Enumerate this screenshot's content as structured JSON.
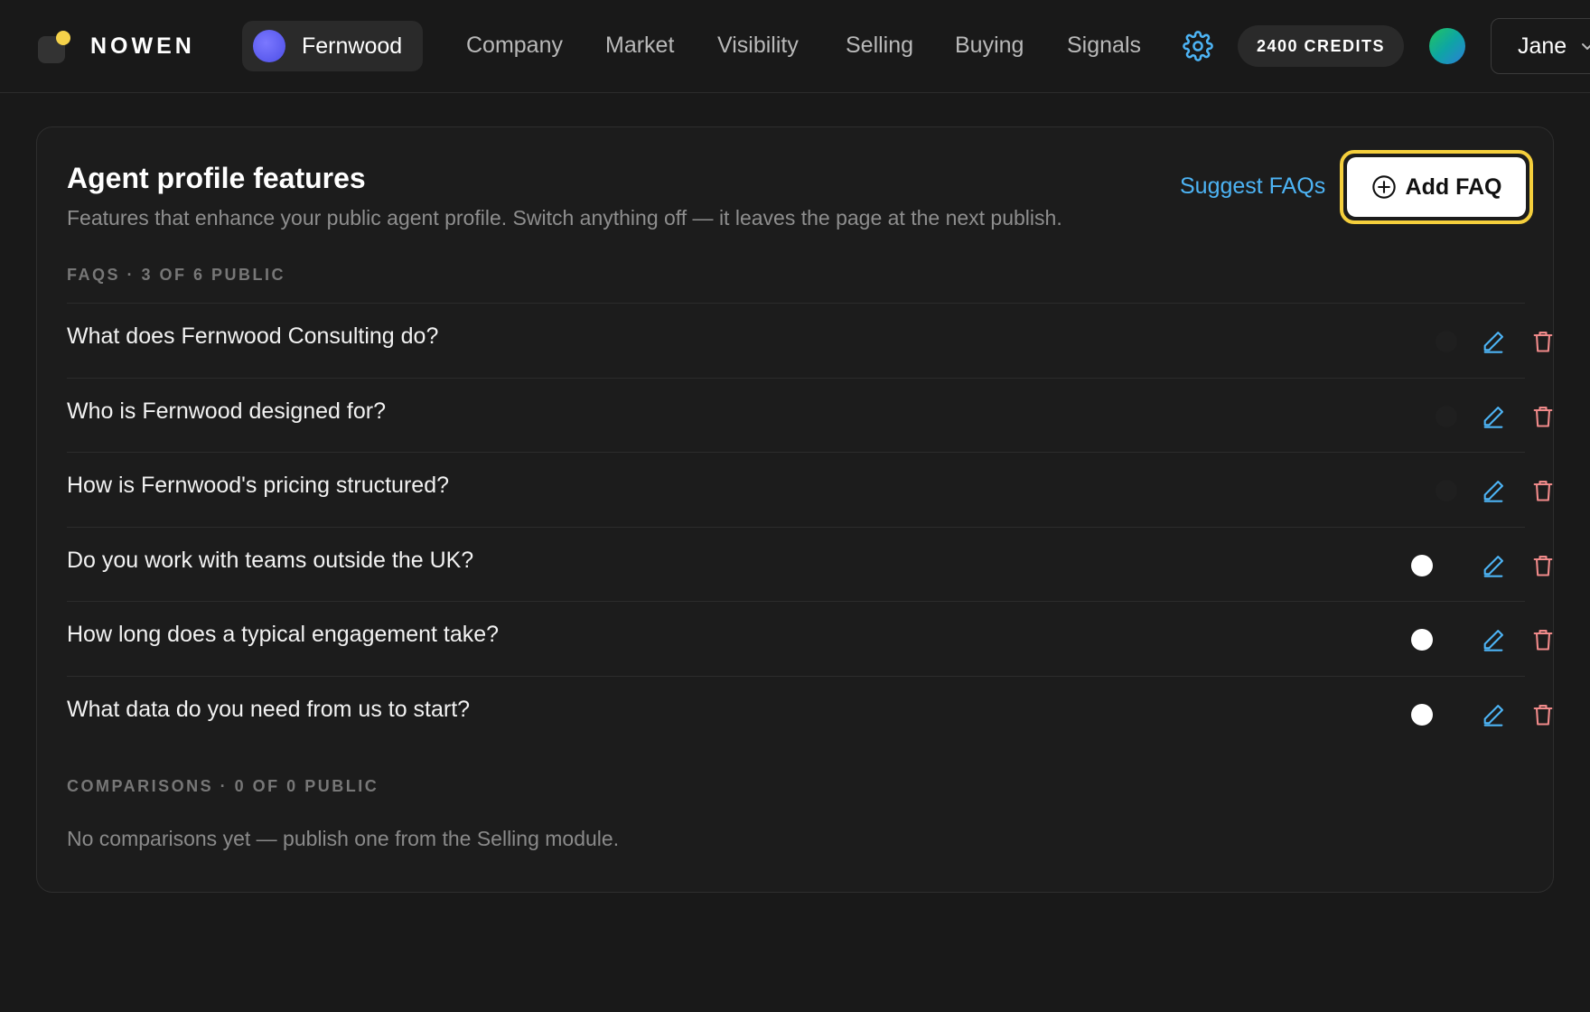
{
  "app": {
    "brand": "NOWEN"
  },
  "workspace": {
    "name": "Fernwood"
  },
  "nav": {
    "items": [
      {
        "label": "Company"
      },
      {
        "label": "Market"
      },
      {
        "label": "Visibility"
      },
      {
        "label": "Selling"
      },
      {
        "label": "Buying"
      },
      {
        "label": "Signals"
      }
    ]
  },
  "header": {
    "credits": "2400 CREDITS",
    "user": "Jane",
    "settings_icon": "gear-icon"
  },
  "card": {
    "title": "Agent profile features",
    "subtitle": "Features that enhance your public agent profile. Switch anything off — it leaves the page at the next publish.",
    "suggest_label": "Suggest FAQs",
    "add_label": "Add FAQ"
  },
  "faqs": {
    "section_label": "FAQS · 3 OF 6 PUBLIC",
    "items": [
      {
        "question": "What does Fernwood Consulting do?",
        "public": false
      },
      {
        "question": "Who is Fernwood designed for?",
        "public": false
      },
      {
        "question": "How is Fernwood's pricing structured?",
        "public": false
      },
      {
        "question": "Do you work with teams outside the UK?",
        "public": true
      },
      {
        "question": "How long does a typical engagement take?",
        "public": true
      },
      {
        "question": "What data do you need from us to start?",
        "public": true
      }
    ]
  },
  "comparisons": {
    "section_label": "COMPARISONS · 0 OF 0 PUBLIC",
    "empty_text": "No comparisons yet — publish one from the Selling module."
  },
  "colors": {
    "accent_blue": "#4db4f5",
    "highlight_yellow": "#f5cf3c",
    "delete_red": "#f08a8a"
  }
}
